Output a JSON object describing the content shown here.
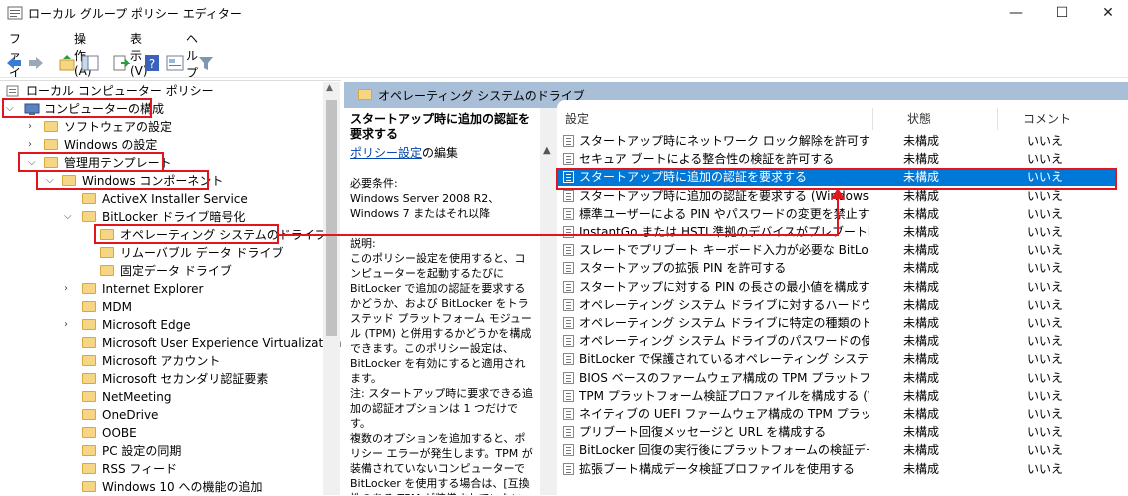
{
  "window": {
    "title": "ローカル グループ ポリシー エディター",
    "minimize": "—",
    "maximize": "☐",
    "close": "✕"
  },
  "menu": [
    "ファイル(F)",
    "操作(A)",
    "表示(V)",
    "ヘルプ(H)"
  ],
  "tree": {
    "root": "ローカル コンピューター ポリシー",
    "computer_config": "コンピューターの構成",
    "software_settings": "ソフトウェアの設定",
    "windows_settings": "Windows の設定",
    "admin_templates": "管理用テンプレート",
    "windows_components": "Windows コンポーネント",
    "activex": "ActiveX Installer Service",
    "bitlocker": "BitLocker ドライブ暗号化",
    "os_drive": "オペレーティング システムのドライブ",
    "removable": "リムーバブル データ ドライブ",
    "fixed": "固定データ ドライブ",
    "ie": "Internet Explorer",
    "mdm": "MDM",
    "edge": "Microsoft Edge",
    "uev": "Microsoft User Experience Virtualization",
    "account": "Microsoft アカウント",
    "secondary_auth": "Microsoft セカンダリ認証要素",
    "netmeeting": "NetMeeting",
    "onedrive": "OneDrive",
    "oobe": "OOBE",
    "pc_sync": "PC 設定の同期",
    "rss": "RSS フィード",
    "win10_features": "Windows 10 への機能の追加"
  },
  "right_header": "オペレーティング システムのドライブ",
  "description": {
    "title": "スタートアップ時に追加の認証を要求する",
    "edit_link": "ポリシー設定",
    "edit_suffix": "の編集",
    "req_label": "必要条件:",
    "req_text": "Windows Server 2008 R2、Windows 7 またはそれ以降",
    "expl_label": "説明:",
    "expl_text": "このポリシー設定を使用すると、コンピューターを起動するたびに BitLocker で追加の認証を要求するかどうか、および BitLocker をトラステッド プラットフォーム モジュール (TPM) と併用するかどうかを構成できます。このポリシー設定は、BitLocker を有効にすると適用されます。",
    "note_text": "注: スタートアップ時に要求できる追加の認証オプションは 1 つだけです。",
    "multi_text": "複数のオプションを追加すると、ポリシー エラーが発生します。TPM が装備されていないコンピューターで BitLocker を使用する場合は、[互換性のある TPM が装備されていない BitLocker を許可"
  },
  "columns": {
    "setting": "設定",
    "state": "状態",
    "comment": "コメント"
  },
  "rows": [
    {
      "name": "スタートアップ時にネットワーク ロック解除を許可する",
      "state": "未構成",
      "comment": "いいえ"
    },
    {
      "name": "セキュア ブートによる整合性の検証を許可する",
      "state": "未構成",
      "comment": "いいえ"
    },
    {
      "name": "スタートアップ時に追加の認証を要求する",
      "state": "未構成",
      "comment": "いいえ"
    },
    {
      "name": "スタートアップ時に追加の認証を要求する (Windows Serve...",
      "state": "未構成",
      "comment": "いいえ"
    },
    {
      "name": "標準ユーザーによる PIN やパスワードの変更を禁止する",
      "state": "未構成",
      "comment": "いいえ"
    },
    {
      "name": "InstantGo または HSTI 準拠のデバイスがプレブート暗証番...",
      "state": "未構成",
      "comment": "いいえ"
    },
    {
      "name": "スレートでプリブート キーボード入力が必要な BitLocker 認証...",
      "state": "未構成",
      "comment": "いいえ"
    },
    {
      "name": "スタートアップの拡張 PIN を許可する",
      "state": "未構成",
      "comment": "いいえ"
    },
    {
      "name": "スタートアップに対する PIN の長さの最小値を構成する",
      "state": "未構成",
      "comment": "いいえ"
    },
    {
      "name": "オペレーティング システム ドライブに対するハードウェア ベースの...",
      "state": "未構成",
      "comment": "いいえ"
    },
    {
      "name": "オペレーティング システム ドライブに特定の種類のドライブ暗...",
      "state": "未構成",
      "comment": "いいえ"
    },
    {
      "name": "オペレーティング システム ドライブのパスワードの使用を構成する",
      "state": "未構成",
      "comment": "いいえ"
    },
    {
      "name": "BitLocker で保護されているオペレーティング システム ドライブ...",
      "state": "未構成",
      "comment": "いいえ"
    },
    {
      "name": "BIOS ベースのファームウェア構成の TPM プラットフォーム検証...",
      "state": "未構成",
      "comment": "いいえ"
    },
    {
      "name": "TPM プラットフォーム検証プロファイルを構成する (Windows ...",
      "state": "未構成",
      "comment": "いいえ"
    },
    {
      "name": "ネイティブの UEFI ファームウェア構成の TPM プラットフォーム...",
      "state": "未構成",
      "comment": "いいえ"
    },
    {
      "name": "プリブート回復メッセージと URL を構成する",
      "state": "未構成",
      "comment": "いいえ"
    },
    {
      "name": "BitLocker 回復の実行後にプラットフォームの検証データをリ...",
      "state": "未構成",
      "comment": "いいえ"
    },
    {
      "name": "拡張ブート構成データ検証プロファイルを使用する",
      "state": "未構成",
      "comment": "いいえ"
    }
  ],
  "colors": {
    "highlight": "#e2141c",
    "selection": "#0078d7",
    "header": "#a9bfd8"
  }
}
